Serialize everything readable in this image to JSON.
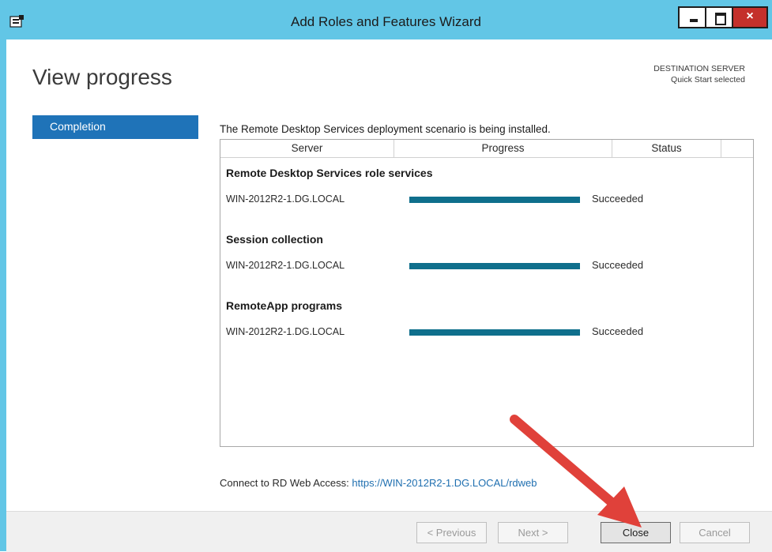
{
  "window": {
    "title": "Add Roles and Features Wizard",
    "controls": {
      "minimize": "minimize-icon",
      "maximize": "maximize-icon",
      "close": "×"
    }
  },
  "page": {
    "title": "View progress",
    "destination_label": "DESTINATION SERVER",
    "destination_value": "Quick Start selected"
  },
  "nav": {
    "items": [
      {
        "label": "Completion",
        "selected": true
      }
    ]
  },
  "main": {
    "intro": "The Remote Desktop Services deployment scenario is being installed.",
    "columns": [
      "Server",
      "Progress",
      "Status",
      ""
    ],
    "groups": [
      {
        "title": "Remote Desktop Services role services",
        "server": "WIN-2012R2-1.DG.LOCAL",
        "progress": 1.0,
        "status": "Succeeded"
      },
      {
        "title": "Session collection",
        "server": "WIN-2012R2-1.DG.LOCAL",
        "progress": 1.0,
        "status": "Succeeded"
      },
      {
        "title": "RemoteApp programs",
        "server": "WIN-2012R2-1.DG.LOCAL",
        "progress": 1.0,
        "status": "Succeeded"
      }
    ],
    "connect_label": "Connect to RD Web Access:",
    "connect_link": "https://WIN-2012R2-1.DG.LOCAL/rdweb"
  },
  "footer": {
    "previous": "< Previous",
    "next": "Next >",
    "close": "Close",
    "cancel": "Cancel"
  },
  "colors": {
    "titlebar": "#62c6e6",
    "nav_selected": "#1f73b8",
    "progress_fill": "#0f6f8c",
    "annotation_arrow": "#e0413a"
  }
}
